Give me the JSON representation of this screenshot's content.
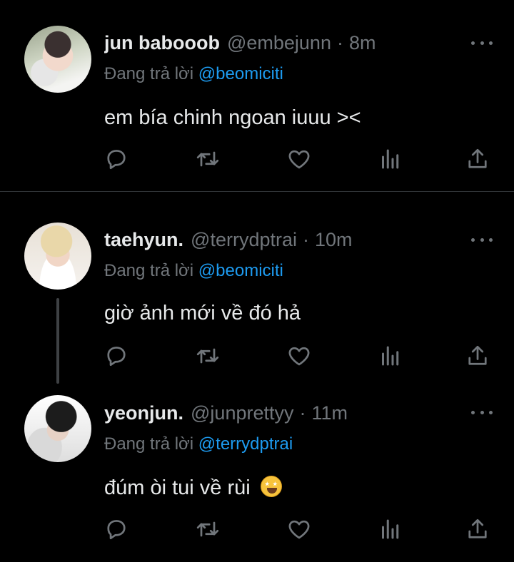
{
  "tweets": [
    {
      "name": "jun babooob",
      "handle": "@embejunn",
      "dot": "·",
      "time": "8m",
      "reply_label": "Đang trả lời",
      "reply_to": "@beomiciti",
      "text": "em bía chinh ngoan iuuu ><",
      "avatar": "avatar-photo"
    },
    {
      "name": "taehyun.",
      "handle": "@terrydptrai",
      "dot": "·",
      "time": "10m",
      "reply_label": "Đang trả lời",
      "reply_to": "@beomiciti",
      "text": "giờ ảnh mới về đó hả",
      "avatar": "avatar-photo"
    },
    {
      "name": "yeonjun.",
      "handle": "@junprettyy",
      "dot": "·",
      "time": "11m",
      "reply_label": "Đang trả lời",
      "reply_to": "@terrydptrai",
      "text": "đúm òi tui về rùi",
      "emoji": "star-struck-emoji",
      "avatar": "avatar-photo"
    }
  ],
  "action_icons": [
    "reply-icon",
    "retweet-icon",
    "like-icon",
    "analytics-icon",
    "share-icon"
  ],
  "colors": {
    "background": "#000000",
    "text_primary": "#e7e9ea",
    "text_secondary": "#71767b",
    "link_blue": "#1d9bf0",
    "divider": "#2f3336"
  }
}
